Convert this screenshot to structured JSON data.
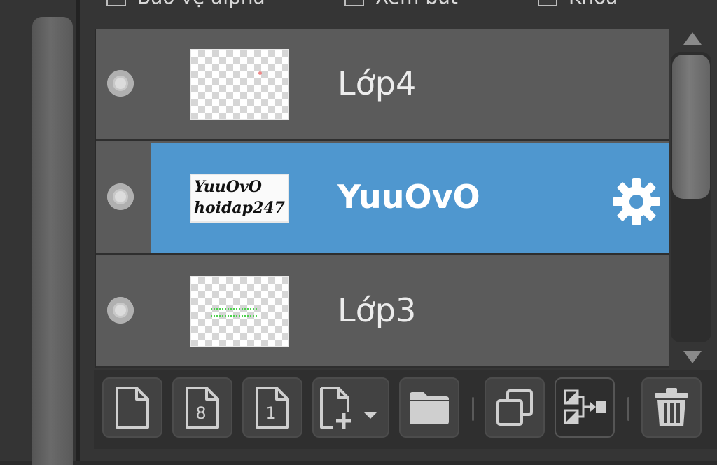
{
  "top_options": [
    {
      "label": "Bảo vệ alpha"
    },
    {
      "label": "Xem bút"
    },
    {
      "label": "Khóa"
    }
  ],
  "layers": [
    {
      "name": "Lớp4",
      "selected": false,
      "thumbnail": "transparent"
    },
    {
      "name": "YuuOvO",
      "selected": true,
      "thumbnail": "text",
      "thumbnail_text": [
        "YuuOvO",
        "hoidap247"
      ]
    },
    {
      "name": "Lớp3",
      "selected": false,
      "thumbnail": "transparent"
    }
  ],
  "toolbar": {
    "new_layer_icon": "new-page-icon",
    "layer_8bit_label": "8",
    "layer_1bit_label": "1",
    "add_layer_menu_icon": "page-plus-dropdown-icon",
    "folder_icon": "folder-icon",
    "duplicate_icon": "duplicate-icon",
    "merge_icon": "merge-down-icon",
    "delete_icon": "trash-icon"
  },
  "colors": {
    "selection": "#4f97cf",
    "row": "#5b5b5b",
    "panel": "#353535"
  }
}
